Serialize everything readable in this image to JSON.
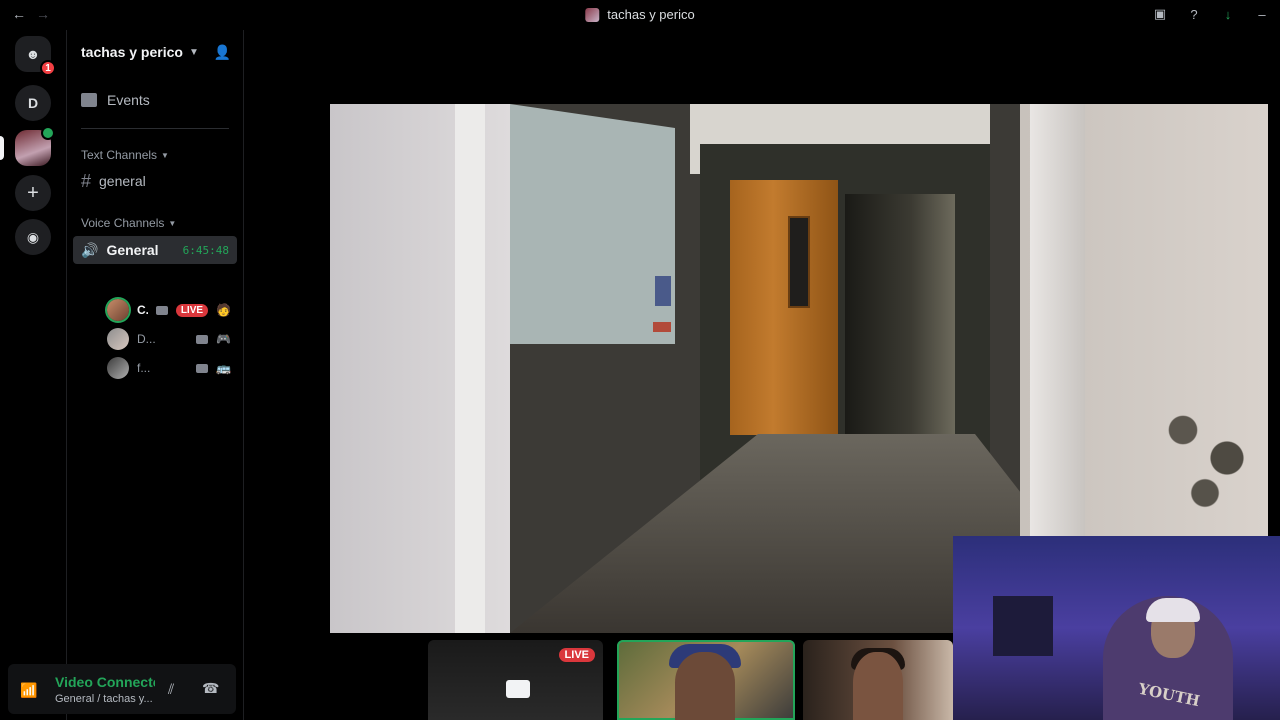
{
  "window": {
    "title": "tachas y perico",
    "back_icon": "←",
    "forward_icon": "→"
  },
  "rail": {
    "home_badge": "1",
    "dm_letter": "D",
    "add_icon": "+",
    "explore_icon": "◉"
  },
  "server": {
    "name": "tachas y perico",
    "events_label": "Events",
    "text_category": "Text Channels",
    "text_channels": [
      {
        "name": "general"
      }
    ],
    "voice_category": "Voice Channels",
    "voice_channel": {
      "name": "General",
      "timer": "6:45:48"
    },
    "voice_users": [
      {
        "name": "C.",
        "live": "LIVE",
        "activity": "🧑"
      },
      {
        "name": "D...",
        "activity": "🎮"
      },
      {
        "name": "f...",
        "activity": "🚌"
      }
    ]
  },
  "voice_panel": {
    "status": "Video Connected",
    "location": "General / tachas y..."
  },
  "stage": {
    "tile_live_label": "LIVE",
    "pip_shirt_text": "YOUTH"
  },
  "colors": {
    "accent_green": "#23a559",
    "live_red": "#da373c",
    "badge_red": "#f23f43"
  }
}
